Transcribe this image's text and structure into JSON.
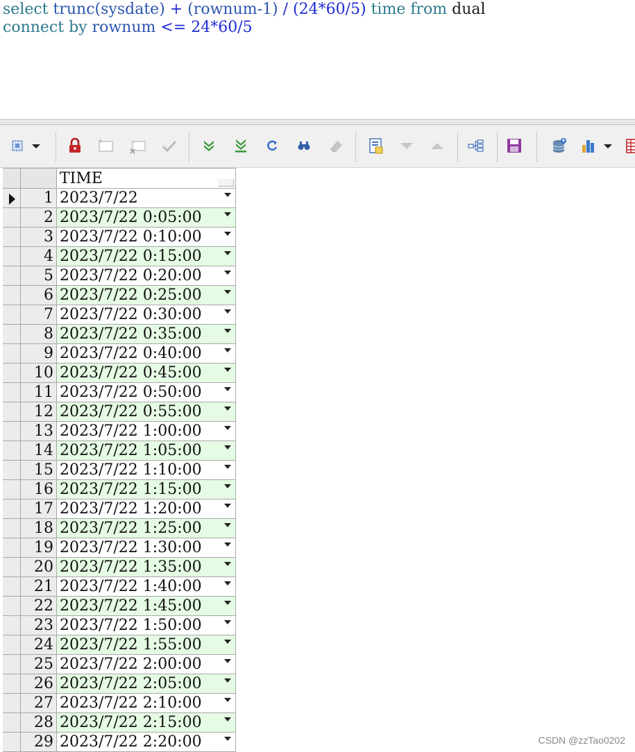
{
  "editor": {
    "line1": [
      {
        "t": "select",
        "c": "kw"
      },
      {
        "t": " ",
        "c": "plain"
      },
      {
        "t": "trunc(sysdate)",
        "c": "fn"
      },
      {
        "t": " + ",
        "c": "op"
      },
      {
        "t": "(rownum-1)",
        "c": "fn"
      },
      {
        "t": " / ",
        "c": "op"
      },
      {
        "t": "(24*60/5)",
        "c": "num"
      },
      {
        "t": " ",
        "c": "plain"
      },
      {
        "t": "time",
        "c": "kw"
      },
      {
        "t": " ",
        "c": "plain"
      },
      {
        "t": "from",
        "c": "kw"
      },
      {
        "t": " dual",
        "c": "plain"
      }
    ],
    "line2": [
      {
        "t": "connect by",
        "c": "kw"
      },
      {
        "t": " ",
        "c": "plain"
      },
      {
        "t": "rownum",
        "c": "fn"
      },
      {
        "t": " <= ",
        "c": "op"
      },
      {
        "t": "24*60/5",
        "c": "num"
      }
    ]
  },
  "toolbar": {
    "icons": [
      "select-columns-icon",
      "dropdown-arrow-icon",
      "lock-icon",
      "insert-record-icon",
      "delete-record-icon",
      "post-changes-icon",
      "fetch-next-page-icon",
      "fetch-last-page-icon",
      "refresh-icon",
      "query-by-example-icon",
      "clear-record-icon",
      "single-record-view-icon",
      "next-record-icon",
      "previous-record-icon",
      "export-tree-icon",
      "save-icon",
      "export-database-icon",
      "chart-icon",
      "chart-dropdown-icon",
      "grid-export-icon"
    ]
  },
  "grid": {
    "column_header": "TIME",
    "rows": [
      {
        "n": "1",
        "time": "2023/7/22"
      },
      {
        "n": "2",
        "time": "2023/7/22 0:05:00"
      },
      {
        "n": "3",
        "time": "2023/7/22 0:10:00"
      },
      {
        "n": "4",
        "time": "2023/7/22 0:15:00"
      },
      {
        "n": "5",
        "time": "2023/7/22 0:20:00"
      },
      {
        "n": "6",
        "time": "2023/7/22 0:25:00"
      },
      {
        "n": "7",
        "time": "2023/7/22 0:30:00"
      },
      {
        "n": "8",
        "time": "2023/7/22 0:35:00"
      },
      {
        "n": "9",
        "time": "2023/7/22 0:40:00"
      },
      {
        "n": "10",
        "time": "2023/7/22 0:45:00"
      },
      {
        "n": "11",
        "time": "2023/7/22 0:50:00"
      },
      {
        "n": "12",
        "time": "2023/7/22 0:55:00"
      },
      {
        "n": "13",
        "time": "2023/7/22 1:00:00"
      },
      {
        "n": "14",
        "time": "2023/7/22 1:05:00"
      },
      {
        "n": "15",
        "time": "2023/7/22 1:10:00"
      },
      {
        "n": "16",
        "time": "2023/7/22 1:15:00"
      },
      {
        "n": "17",
        "time": "2023/7/22 1:20:00"
      },
      {
        "n": "18",
        "time": "2023/7/22 1:25:00"
      },
      {
        "n": "19",
        "time": "2023/7/22 1:30:00"
      },
      {
        "n": "20",
        "time": "2023/7/22 1:35:00"
      },
      {
        "n": "21",
        "time": "2023/7/22 1:40:00"
      },
      {
        "n": "22",
        "time": "2023/7/22 1:45:00"
      },
      {
        "n": "23",
        "time": "2023/7/22 1:50:00"
      },
      {
        "n": "24",
        "time": "2023/7/22 1:55:00"
      },
      {
        "n": "25",
        "time": "2023/7/22 2:00:00"
      },
      {
        "n": "26",
        "time": "2023/7/22 2:05:00"
      },
      {
        "n": "27",
        "time": "2023/7/22 2:10:00"
      },
      {
        "n": "28",
        "time": "2023/7/22 2:15:00"
      },
      {
        "n": "29",
        "time": "2023/7/22 2:20:00"
      }
    ]
  },
  "watermark": "CSDN @zzTao0202",
  "colors": {
    "alt_row": "#e5fbe3",
    "keyword": "#2b7a8c",
    "number": "#1f2cd4"
  }
}
